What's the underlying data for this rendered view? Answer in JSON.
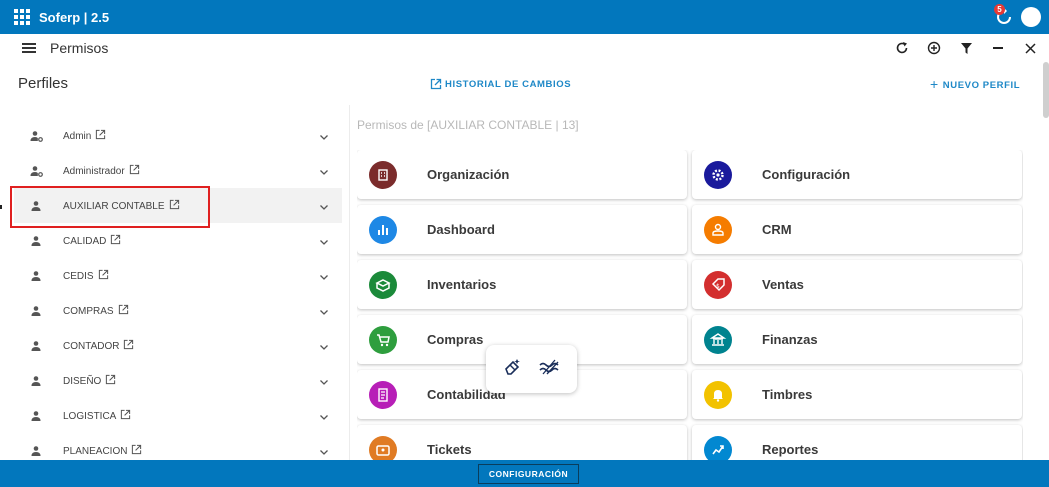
{
  "app": {
    "title": "Soferp | 2.5",
    "notification_count": "5"
  },
  "subheader": {
    "title": "Permisos"
  },
  "profiles_panel": {
    "title": "Perfiles",
    "historial_label": "HISTORIAL DE CAMBIOS",
    "nuevo_label": "NUEVO PERFIL",
    "items": [
      {
        "label": "Admin",
        "icon": "user-gear-icon"
      },
      {
        "label": "Administrador",
        "icon": "user-gear-icon"
      },
      {
        "label": "AUXILIAR CONTABLE",
        "icon": "user-icon",
        "selected": true
      },
      {
        "label": "CALIDAD",
        "icon": "user-icon"
      },
      {
        "label": "CEDIS",
        "icon": "user-icon"
      },
      {
        "label": "COMPRAS",
        "icon": "user-icon"
      },
      {
        "label": "CONTADOR",
        "icon": "user-icon"
      },
      {
        "label": "DISEÑO",
        "icon": "user-icon"
      },
      {
        "label": "LOGISTICA",
        "icon": "user-icon"
      },
      {
        "label": "PLANEACION",
        "icon": "user-icon"
      }
    ]
  },
  "permisos": {
    "label": "Permisos de [AUXILIAR CONTABLE | 13]",
    "modules": [
      {
        "label": "Organización",
        "color": "#7b2c2c",
        "icon": "building-icon"
      },
      {
        "label": "Configuración",
        "color": "#1a1a9c",
        "icon": "settings-icon"
      },
      {
        "label": "Dashboard",
        "color": "#1e88e5",
        "icon": "bar-chart-icon"
      },
      {
        "label": "CRM",
        "color": "#f57c00",
        "icon": "contact-icon"
      },
      {
        "label": "Inventarios",
        "color": "#1b8a3a",
        "icon": "box-icon"
      },
      {
        "label": "Ventas",
        "color": "#d32f2f",
        "icon": "price-tag-icon"
      },
      {
        "label": "Compras",
        "color": "#2e9e3e",
        "icon": "cart-icon"
      },
      {
        "label": "Finanzas",
        "color": "#00838f",
        "icon": "bank-icon"
      },
      {
        "label": "Contabilidad",
        "color": "#b71fb7",
        "icon": "ledger-icon"
      },
      {
        "label": "Timbres",
        "color": "#f2c200",
        "icon": "bell-icon"
      },
      {
        "label": "Tickets",
        "color": "#e07b24",
        "icon": "ticket-icon"
      },
      {
        "label": "Reportes",
        "color": "#0288d1",
        "icon": "report-icon"
      }
    ]
  },
  "footer": {
    "config_label": "CONFIGURACIÓN"
  }
}
